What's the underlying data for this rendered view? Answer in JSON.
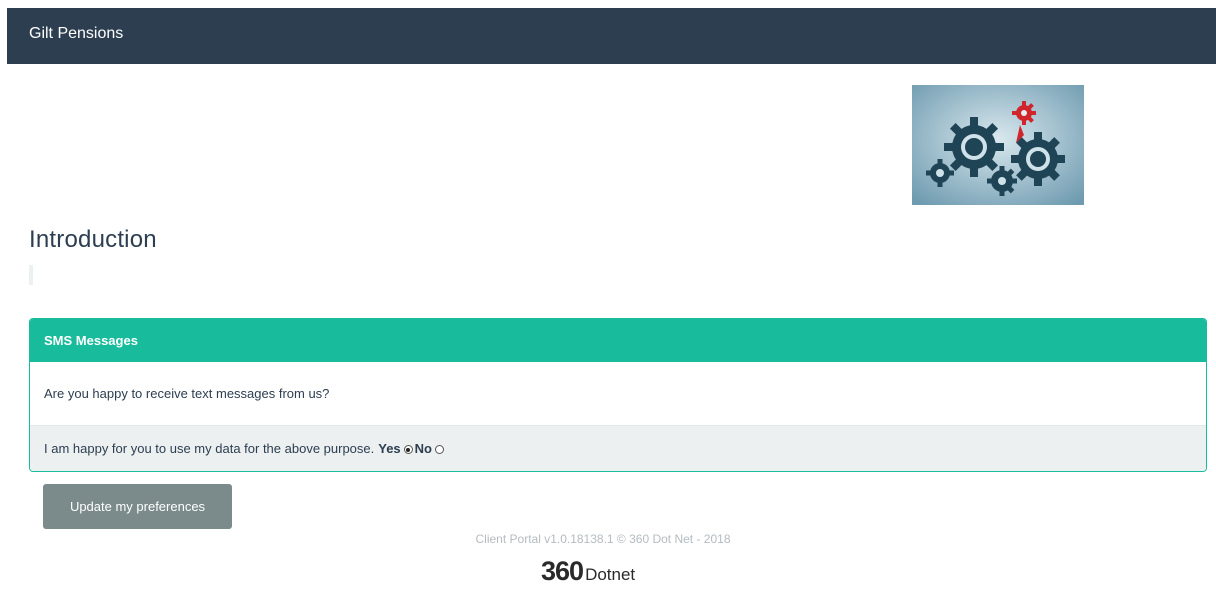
{
  "header": {
    "brand": "Gilt Pensions"
  },
  "page": {
    "title": "Introduction",
    "hero_image_icon": "gears-icon"
  },
  "panel": {
    "heading": "SMS Messages",
    "question": "Are you happy to receive text messages from us?",
    "consent_text": "I am happy for you to use my data for the above purpose.",
    "yes_label": "Yes",
    "no_label": "No",
    "selected": "Yes"
  },
  "actions": {
    "update_label": "Update my preferences"
  },
  "footer": {
    "version_text": "Client Portal v1.0.18138.1 © 360 Dot Net - 2018",
    "logo_number": "360",
    "logo_word": "Dotnet"
  },
  "colors": {
    "navbar": "#2c3e50",
    "panel_heading": "#18bc9c",
    "button": "#7b8a8b",
    "footer_text": "#b4bcc2"
  }
}
